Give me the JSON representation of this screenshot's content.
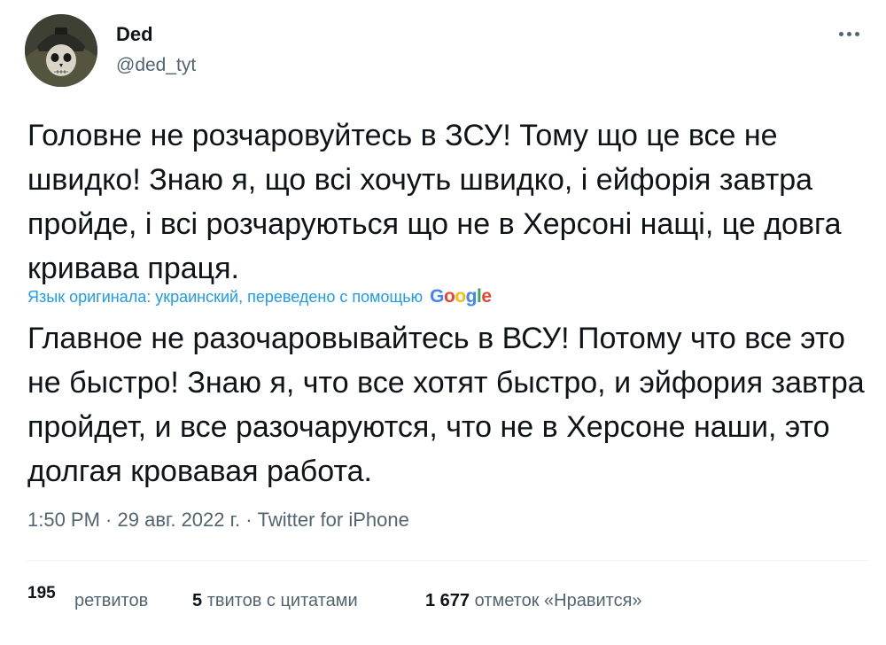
{
  "author": {
    "name": "Ded",
    "handle": "@ded_tyt"
  },
  "menu": {
    "icon": "more-horizontal-icon"
  },
  "tweet": {
    "text": "Головне не розчаровуйтесь в ЗСУ! Тому що це все не швидко! Знаю я, що всі хочуть швидко, і ейфорія завтра пройде, і всі розчаруються що не в Херсоні нащі, це довга кривава праця.",
    "translation_note": "Язык оригинала: украинский, переведено с помощью",
    "translation_provider": "Google",
    "translated_text": "Главное не разочаровывайтесь в ВСУ! Потому что все это не быстро! Знаю я, что все хотят быстро, и эйфория завтра пройдет, и все разочаруются, что не в Херсоне наши, это долгая кровавая работа."
  },
  "meta": {
    "time": "1:50 PM",
    "separator": " · ",
    "date": "29 авг. 2022 г.",
    "source": "Twitter for iPhone"
  },
  "stats": {
    "retweets_count": "195",
    "retweets_label": "ретвитов",
    "quotes_count": "5",
    "quotes_label": "твитов с цитатами",
    "likes_count": "1 677",
    "likes_label": "отметок «Нравится»"
  },
  "colors": {
    "text": "#0f1419",
    "secondary": "#536471",
    "link": "#1d9bf0",
    "divider": "#eff3f4"
  }
}
